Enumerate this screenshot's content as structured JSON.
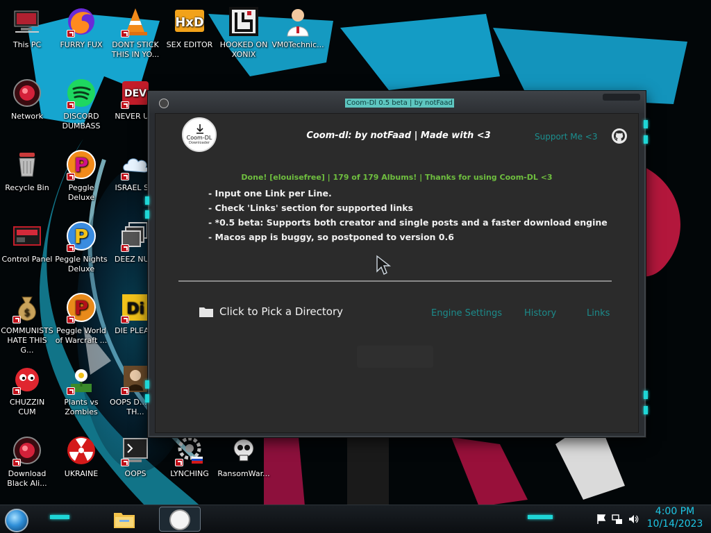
{
  "desktop": {
    "icons": [
      {
        "label": "This PC",
        "kind": "pc-icon"
      },
      {
        "label": "FURRY FUX",
        "kind": "firefox-icon"
      },
      {
        "label": "DONT STICK THIS IN YO...",
        "kind": "vlc-cone-icon"
      },
      {
        "label": "SEX EDITOR",
        "kind": "hex-editor-icon"
      },
      {
        "label": "HOOKED ON XONIX",
        "kind": "xonix-game-icon"
      },
      {
        "label": "VM0Technic...",
        "kind": "doctor-icon"
      },
      {
        "label": "Network",
        "kind": "network-icon"
      },
      {
        "label": "DISCORD DUMBASS",
        "kind": "spotify-icon"
      },
      {
        "label": "NEVER U...",
        "kind": "dev-icon"
      },
      {
        "label": "Recycle Bin",
        "kind": "recycle-bin-icon"
      },
      {
        "label": "Peggle Deluxe",
        "kind": "peggle-icon"
      },
      {
        "label": "ISRAEL S...",
        "kind": "cloud-icon"
      },
      {
        "label": "Control Panel",
        "kind": "control-panel-icon"
      },
      {
        "label": "Peggle Nights Deluxe",
        "kind": "peggle-nights-icon"
      },
      {
        "label": "DEEZ NU...",
        "kind": "stacked-windows-icon"
      },
      {
        "label": "COMMUNISTS HATE THIS G...",
        "kind": "money-bag-icon"
      },
      {
        "label": "Peggle World of Warcraft ...",
        "kind": "peggle-wow-icon"
      },
      {
        "label": "DIE PLEA...",
        "kind": "die-game-icon"
      },
      {
        "label": "CHUZZIN CUM",
        "kind": "chuzzle-icon"
      },
      {
        "label": "Plants vs Zombies",
        "kind": "pvz-flower-icon"
      },
      {
        "label": "OOPS D... DO TH...",
        "kind": "portrait-icon"
      },
      {
        "label": "Download Black Ali...",
        "kind": "network-icon"
      },
      {
        "label": "UKRAINE",
        "kind": "radiation-icon"
      },
      {
        "label": "OOPS",
        "kind": "terminal-icon"
      },
      {
        "label": "LYNCHING",
        "kind": "gear-cluster-icon"
      },
      {
        "label": "RansomWar...",
        "kind": "skull-icon"
      }
    ]
  },
  "window": {
    "title": "Coom-Dl 0.5 beta | by notFaad",
    "logo_text": "Coom-DL",
    "logo_subtext": "Downloader",
    "headline": "Coom-dl:  by notFaad  |  Made with <3",
    "support_link": "Support Me <3",
    "status": "Done! [elouisefree] | 179 of 179 Albums! | Thanks for using Coom-DL <3",
    "info_lines": [
      "- Input one Link per Line.",
      "- Check 'Links' section for supported links",
      "- *0.5 beta: Supports both creator and single posts and a faster download engine",
      "- Macos app is buggy, so postponed to version 0.6"
    ],
    "pick_directory": "Click to Pick a Directory",
    "nav": {
      "engine_settings": "Engine Settings",
      "history": "History",
      "links": "Links"
    }
  },
  "taskbar": {
    "time": "4:00 PM",
    "date": "10/14/2023"
  },
  "colors": {
    "accent_cyan": "#1ed6d6",
    "link_teal": "#1c8b8b",
    "status_green": "#6fbf3f",
    "clock_blue": "#1ec8e6"
  }
}
